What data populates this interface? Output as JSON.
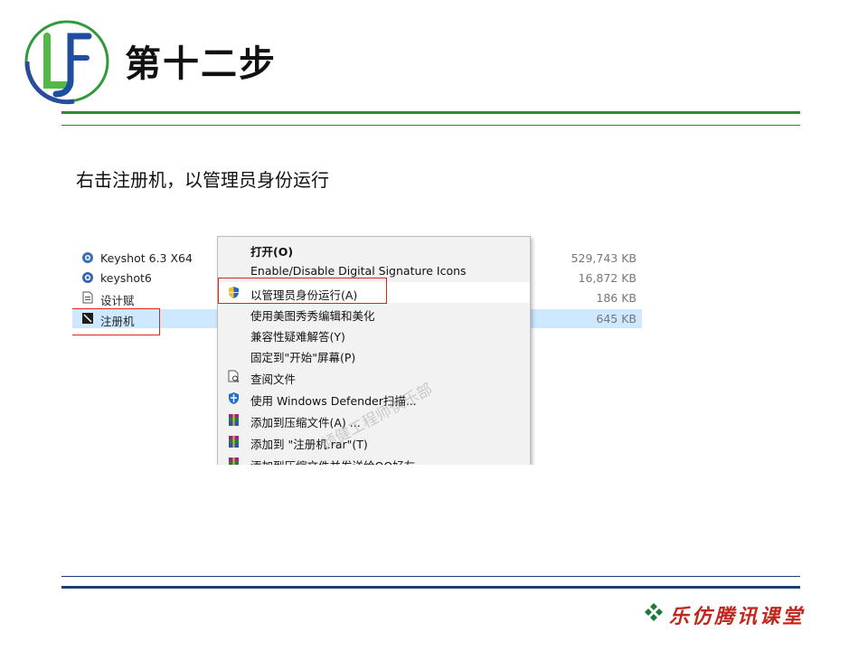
{
  "slide": {
    "logo_text": "LF",
    "title": "第十二步",
    "instruction": "右击注册机，以管理员身份运行",
    "footer_brand": "乐仿腾讯课堂"
  },
  "file_list": [
    {
      "name": "Keyshot 6.3 X64",
      "size": "529,743 KB",
      "icon": "keyshot-app-icon",
      "selected": false
    },
    {
      "name": "keyshot6",
      "size": "16,872 KB",
      "icon": "keyshot-app-icon",
      "selected": false
    },
    {
      "name": "设计赋",
      "size": "186 KB",
      "icon": "document-icon",
      "selected": false
    },
    {
      "name": "注册机",
      "size": "645 KB",
      "icon": "keygen-app-icon",
      "selected": true
    }
  ],
  "context_menu": {
    "items": [
      {
        "label": "打开(O)",
        "icon": "",
        "bold": true,
        "highlighted": false
      },
      {
        "label": "Enable/Disable Digital Signature Icons",
        "icon": "",
        "bold": false,
        "highlighted": false
      },
      {
        "label": "以管理员身份运行(A)",
        "icon": "uac-shield-icon",
        "bold": false,
        "highlighted": true
      },
      {
        "label": "使用美图秀秀编辑和美化",
        "icon": "",
        "bold": false,
        "highlighted": false
      },
      {
        "label": "兼容性疑难解答(Y)",
        "icon": "",
        "bold": false,
        "highlighted": false
      },
      {
        "label": "固定到\"开始\"屏幕(P)",
        "icon": "",
        "bold": false,
        "highlighted": false
      },
      {
        "label": "查阅文件",
        "icon": "file-search-icon",
        "bold": false,
        "highlighted": false
      },
      {
        "label": "使用 Windows Defender扫描...",
        "icon": "defender-icon",
        "bold": false,
        "highlighted": false
      },
      {
        "label": "添加到压缩文件(A) ...",
        "icon": "winrar-icon",
        "bold": false,
        "highlighted": false
      },
      {
        "label": "添加到 \"注册机.rar\"(T)",
        "icon": "winrar-icon",
        "bold": false,
        "highlighted": false
      },
      {
        "label": "添加到压缩文件并发送给QQ好友",
        "icon": "winrar-icon",
        "bold": false,
        "highlighted": false
      }
    ]
  },
  "watermark": "倾健工程师俱乐部",
  "colors": {
    "green_rule": "#2e8b2e",
    "blue_rule": "#1f3f73",
    "highlight_box": "#d9261c",
    "selection": "#cde8ff",
    "brand_red": "#c0281d"
  }
}
